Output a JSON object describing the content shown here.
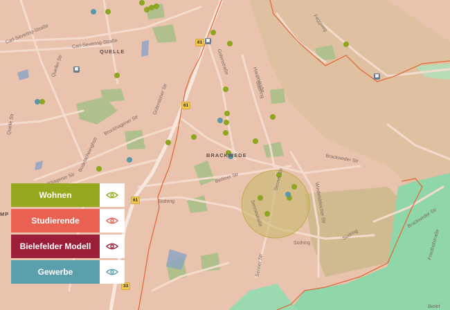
{
  "map": {
    "districts": [
      "QUELLE",
      "BRACKWEDE"
    ],
    "streets": [
      "Carl-Severing-Straße",
      "Carl-Severing-Straße",
      "Queller Str",
      "Quelle Str",
      "Gütersloher Str",
      "Brockhagener Str",
      "Brockhagener Str",
      "Bodelschwinghstr",
      "Gotenstraße",
      "Hauptstraße",
      "Stadring",
      "Berliner Str",
      "Südring",
      "Südring",
      "Brackweder Str",
      "Windelsbleicher Str",
      "Senner Str",
      "Senner Str",
      "Brackweder Str",
      "Friedhofstraße",
      "Feggweg",
      "Südring",
      "Sennestraße",
      "Bielef"
    ],
    "road_numbers": [
      "61",
      "61",
      "61",
      "33"
    ],
    "transit_icons": [
      "transit-icon",
      "transit-icon",
      "transit-icon"
    ],
    "colors": {
      "background": "#e9c3ae",
      "boundary": "#e06a3a",
      "forest": "#8fd6a8",
      "park": "#a9c08a",
      "water": "#8aa3c4",
      "highlight_circle": "#c9b86a"
    }
  },
  "legend": {
    "items": [
      {
        "label": "Wohnen",
        "color": "#98a81e",
        "eye_color": "#98a81e",
        "icon": "eye-icon"
      },
      {
        "label": "Studierende",
        "color": "#e96150",
        "eye_color": "#e96150",
        "icon": "eye-icon"
      },
      {
        "label": "Bielefelder Modell",
        "color": "#9c1f3a",
        "eye_color": "#9c1f3a",
        "icon": "eye-icon"
      },
      {
        "label": "Gewerbe",
        "color": "#5b9fad",
        "eye_color": "#5b9fad",
        "icon": "eye-icon"
      }
    ]
  },
  "markers": {
    "wohnen_color": "#8ea51f",
    "gewerbe_color": "#5a97a8"
  },
  "corner_text": {
    "left": "MP"
  }
}
